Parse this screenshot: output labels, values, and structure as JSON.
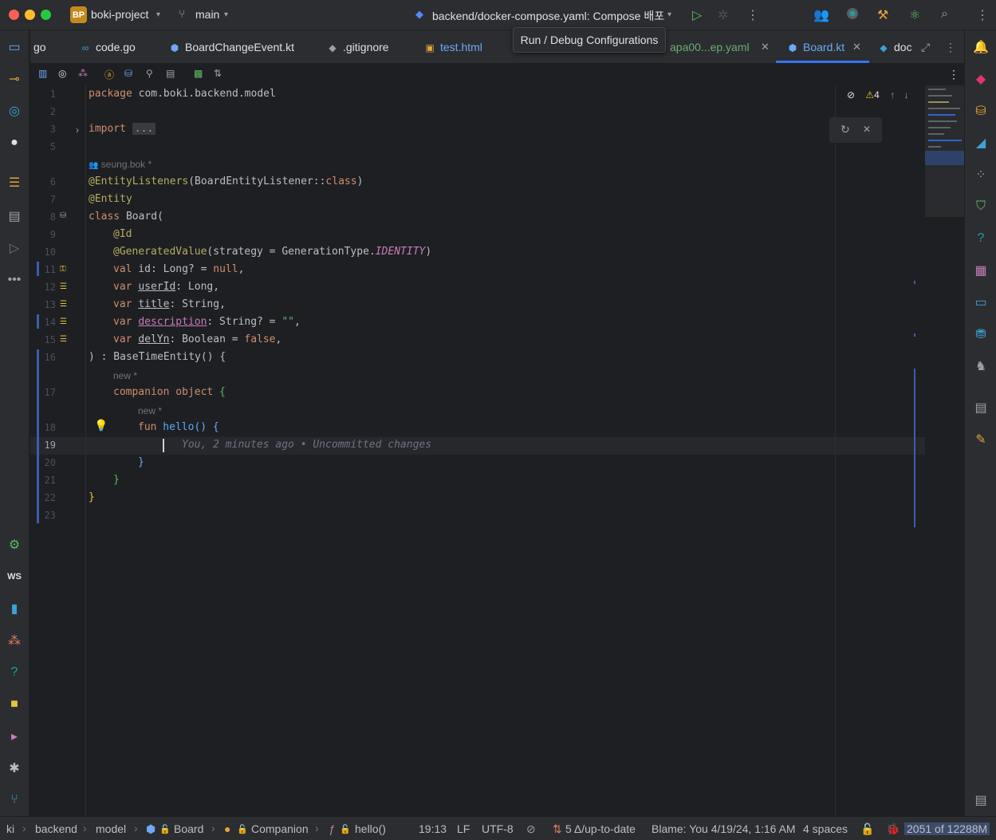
{
  "titlebar": {
    "project_badge": "BP",
    "project_name": "boki-project",
    "branch": "main",
    "run_config": "backend/docker-compose.yaml: Compose 배포"
  },
  "tooltip": "Run / Debug Configurations",
  "tabs": [
    {
      "label": "go"
    },
    {
      "label": "code.go"
    },
    {
      "label": "BoardChangeEvent.kt"
    },
    {
      "label": ".gitignore"
    },
    {
      "label": "test.html"
    },
    {
      "label": "apa00...ep.yaml"
    },
    {
      "label": "Board.kt",
      "active": true
    },
    {
      "label": "doc"
    }
  ],
  "inspection": {
    "warnings": "4"
  },
  "editor": {
    "author_hint": "seung.bok *",
    "new_hint": "new *",
    "blame_inline": "You, 2 minutes ago • Uncommitted changes",
    "lines": [
      {
        "n": "1"
      },
      {
        "n": "2"
      },
      {
        "n": "3"
      },
      {
        "n": "5"
      },
      {
        "n": "6"
      },
      {
        "n": "7"
      },
      {
        "n": "8"
      },
      {
        "n": "9"
      },
      {
        "n": "10"
      },
      {
        "n": "11"
      },
      {
        "n": "12"
      },
      {
        "n": "13"
      },
      {
        "n": "14"
      },
      {
        "n": "15"
      },
      {
        "n": "16"
      },
      {
        "n": "17"
      },
      {
        "n": "18"
      },
      {
        "n": "19"
      },
      {
        "n": "20"
      },
      {
        "n": "21"
      },
      {
        "n": "22"
      },
      {
        "n": "23"
      }
    ],
    "code": {
      "l1_kw": "package",
      "l1_rest": " com.boki.backend.model",
      "l3_kw": "import",
      "l3_fold": "...",
      "l6_ann": "@EntityListeners",
      "l6_rest_a": "(BoardEntityListener::",
      "l6_rest_b": "class",
      "l6_rest_c": ")",
      "l7": "@Entity",
      "l8_kw": "class",
      "l8_rest": " Board(",
      "l9": "@Id",
      "l10_ann": "@GeneratedValue",
      "l10_a": "(strategy = GenerationType.",
      "l10_b": "IDENTITY",
      "l10_c": ")",
      "l11_kw": "val",
      "l11_a": " id",
      "l11_b": ": Long? = ",
      "l11_c": "null",
      "l11_d": ",",
      "l12_kw": "var",
      "l12_a": "userId",
      "l12_b": ": Long,",
      "l13_kw": "var",
      "l13_a": "title",
      "l13_b": ": String,",
      "l14_kw": "var",
      "l14_a": "description",
      "l14_b": ": String? = ",
      "l14_c": "\"\"",
      "l14_d": ",",
      "l15_kw": "var",
      "l15_a": "delYn",
      "l15_b": ": Boolean = ",
      "l15_c": "false",
      "l15_d": ",",
      "l16": ") : BaseTimeEntity() {",
      "l17_kw": "companion object",
      "l17_b": " {",
      "l18_kw": "fun",
      "l18_fn": " hello",
      "l18_b": "() {",
      "l20": "}",
      "l21": "}",
      "l22": "}"
    }
  },
  "statusbar": {
    "crumbs": [
      "ki",
      "backend",
      "model",
      "Board",
      "Companion",
      "hello()"
    ],
    "position": "19:13",
    "line_sep": "LF",
    "encoding": "UTF-8",
    "vcs": "5 Δ/up-to-date",
    "blame": "Blame: You 4/19/24, 1:16 AM",
    "indent": "4 spaces",
    "memory": "2051 of 12288M"
  }
}
